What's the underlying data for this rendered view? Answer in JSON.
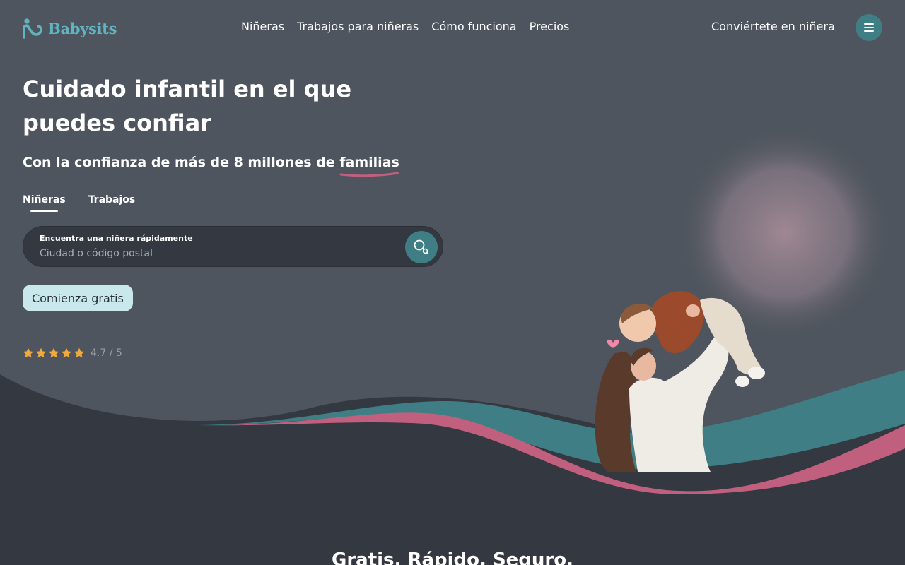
{
  "brand": {
    "name": "Babysits",
    "accent": "#62b3c0",
    "teal": "#3f7e84",
    "pink": "#c0607e"
  },
  "nav": {
    "links": [
      "Niñeras",
      "Trabajos para niñeras",
      "Cómo funciona",
      "Precios"
    ],
    "become_label": "Conviértete en niñera",
    "menu_icon": "hamburger-icon"
  },
  "hero": {
    "headline": "Cuidado infantil en el que puedes confiar",
    "subhead_prefix": "Con la confianza de más de 8 millones de ",
    "subhead_emphasis": "familias",
    "tabs": [
      {
        "label": "Niñeras",
        "active": true
      },
      {
        "label": "Trabajos",
        "active": false
      }
    ],
    "search": {
      "label": "Encuentra una niñera rápidamente",
      "placeholder": "Ciudad o código postal",
      "icon": "search-icon"
    },
    "cta_label": "Comienza gratis",
    "rating": {
      "stars": 5,
      "text": "4.7 / 5",
      "star_color": "#f2a93b"
    }
  },
  "next_section": {
    "title": "Gratis. Rápido. Seguro."
  }
}
